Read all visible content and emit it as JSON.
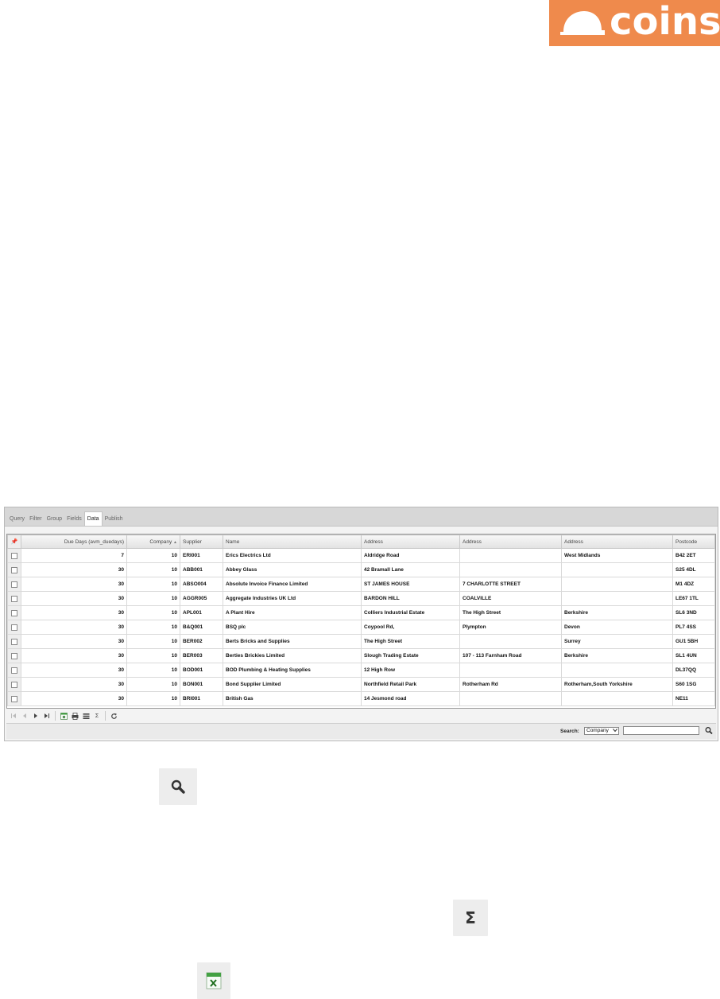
{
  "brand": {
    "logo_text": "coins",
    "logo_color": "#ef8a4c"
  },
  "tabs": [
    {
      "label": "Query"
    },
    {
      "label": "Filter"
    },
    {
      "label": "Group"
    },
    {
      "label": "Fields"
    },
    {
      "label": "Data",
      "active": true
    },
    {
      "label": "Publish"
    }
  ],
  "grid": {
    "columns": [
      {
        "label": ""
      },
      {
        "label": "Due Days (avm_duedays)"
      },
      {
        "label": "Company",
        "sort": "▲"
      },
      {
        "label": "Supplier"
      },
      {
        "label": "Name"
      },
      {
        "label": "Address"
      },
      {
        "label": "Address"
      },
      {
        "label": "Address"
      },
      {
        "label": "Postcode"
      }
    ],
    "rows": [
      {
        "due": "7",
        "company": "10",
        "supplier": "ERI001",
        "name": "Erics Electrics Ltd",
        "addr1": "Aldridge Road",
        "addr2": "",
        "addr3": "West Midlands",
        "postcode": "B42 2ET"
      },
      {
        "due": "30",
        "company": "10",
        "supplier": "ABB001",
        "name": "Abbey Glass",
        "addr1": "42 Bramall Lane",
        "addr2": "",
        "addr3": "",
        "postcode": "S25 4DL"
      },
      {
        "due": "30",
        "company": "10",
        "supplier": "ABSO004",
        "name": "Absolute Invoice Finance Limited",
        "addr1": "ST JAMES HOUSE",
        "addr2": "7 CHARLOTTE STREET",
        "addr3": "",
        "postcode": "M1 4DZ"
      },
      {
        "due": "30",
        "company": "10",
        "supplier": "AGGR005",
        "name": "Aggregate Industries UK Ltd",
        "addr1": "BARDON HILL",
        "addr2": "COALVILLE",
        "addr3": "",
        "postcode": "LE67 1TL"
      },
      {
        "due": "30",
        "company": "10",
        "supplier": "APL001",
        "name": "A Plant Hire",
        "addr1": "Colliers Industrial Estate",
        "addr2": "The High Street",
        "addr3": "Berkshire",
        "postcode": "SL6 3ND"
      },
      {
        "due": "30",
        "company": "10",
        "supplier": "B&Q001",
        "name": "BSQ plc",
        "addr1": "Coypool Rd,",
        "addr2": "Plympton",
        "addr3": "Devon",
        "postcode": "PL7 4SS"
      },
      {
        "due": "30",
        "company": "10",
        "supplier": "BER002",
        "name": "Berts Bricks and Supplies",
        "addr1": "The High Street",
        "addr2": "",
        "addr3": "Surrey",
        "postcode": "GU1 5BH"
      },
      {
        "due": "30",
        "company": "10",
        "supplier": "BER003",
        "name": "Berties Brickies Limited",
        "addr1": "Slough Trading Estate",
        "addr2": "107 - 113 Farnham Road",
        "addr3": "Berkshire",
        "postcode": "SL1 4UN"
      },
      {
        "due": "30",
        "company": "10",
        "supplier": "BOD001",
        "name": "BOD Plumbing & Heating Supplies",
        "addr1": "12 High Row",
        "addr2": "",
        "addr3": "",
        "postcode": "DL37QQ"
      },
      {
        "due": "30",
        "company": "10",
        "supplier": "BON001",
        "name": "Bond Supplier Limited",
        "addr1": "Northfield Retail Park",
        "addr2": "Rotherham Rd",
        "addr3": "Rotherham,South Yorkshire",
        "postcode": "S60 1SG"
      },
      {
        "due": "30",
        "company": "10",
        "supplier": "BRI001",
        "name": "British Gas",
        "addr1": "14 Jesmond road",
        "addr2": "",
        "addr3": "",
        "postcode": "NE11"
      }
    ]
  },
  "toolbar": {
    "first": "first-page-icon",
    "prev": "prev-page-icon",
    "next": "next-page-icon",
    "last": "last-page-icon",
    "excel": "excel-export-icon",
    "print": "print-icon",
    "columns": "columns-icon",
    "sigma_glyph": "Σ",
    "refresh": "refresh-icon"
  },
  "search": {
    "label": "Search:",
    "field": "Company",
    "value": ""
  },
  "standalone_icons": {
    "sigma_glyph": "Σ"
  }
}
